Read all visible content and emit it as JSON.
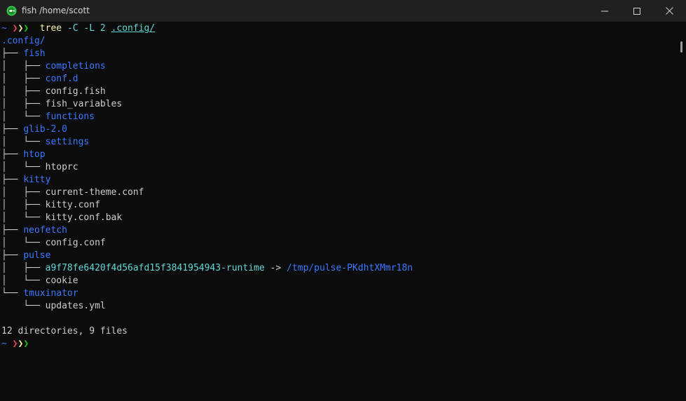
{
  "window": {
    "title": "fish /home/scott",
    "app_icon": "fish-icon",
    "controls": {
      "minimize_icon": "minimize-icon",
      "maximize_icon": "maximize-icon",
      "close_icon": "close-icon"
    }
  },
  "colors": {
    "background": "#0c0c0c",
    "titlebar": "#202020",
    "directory": "#3b78ff",
    "symlink": "#61d6d6",
    "text": "#cccccc",
    "prompt_red": "#e74856",
    "prompt_yellow": "#f9f1a5",
    "prompt_green": "#16c60c",
    "command": "#f9f1a5"
  },
  "terminal": {
    "prompt": {
      "cwd": "~",
      "arrows": [
        "❯",
        "❯",
        "❯"
      ]
    },
    "command": {
      "name": "tree",
      "flags": "-C -L 2",
      "path": ".config/"
    },
    "tree": {
      "root": ".config/",
      "lines": [
        {
          "prefix": "├── ",
          "name": "fish",
          "kind": "dir"
        },
        {
          "prefix": "│   ├── ",
          "name": "completions",
          "kind": "dir"
        },
        {
          "prefix": "│   ├── ",
          "name": "conf.d",
          "kind": "dir"
        },
        {
          "prefix": "│   ├── ",
          "name": "config.fish",
          "kind": "file"
        },
        {
          "prefix": "│   ├── ",
          "name": "fish_variables",
          "kind": "file"
        },
        {
          "prefix": "│   └── ",
          "name": "functions",
          "kind": "dir"
        },
        {
          "prefix": "├── ",
          "name": "glib-2.0",
          "kind": "dir"
        },
        {
          "prefix": "│   └── ",
          "name": "settings",
          "kind": "dir"
        },
        {
          "prefix": "├── ",
          "name": "htop",
          "kind": "dir"
        },
        {
          "prefix": "│   └── ",
          "name": "htoprc",
          "kind": "file"
        },
        {
          "prefix": "├── ",
          "name": "kitty",
          "kind": "dir"
        },
        {
          "prefix": "│   ├── ",
          "name": "current-theme.conf",
          "kind": "file"
        },
        {
          "prefix": "│   ├── ",
          "name": "kitty.conf",
          "kind": "file"
        },
        {
          "prefix": "│   └── ",
          "name": "kitty.conf.bak",
          "kind": "file"
        },
        {
          "prefix": "├── ",
          "name": "neofetch",
          "kind": "dir"
        },
        {
          "prefix": "│   └── ",
          "name": "config.conf",
          "kind": "file"
        },
        {
          "prefix": "├── ",
          "name": "pulse",
          "kind": "dir"
        },
        {
          "prefix": "│   ├── ",
          "name": "a9f78fe6420f4d56afd15f3841954943-runtime",
          "kind": "symlink",
          "arrow": " -> ",
          "target": "/tmp/pulse-PKdhtXMmr18n"
        },
        {
          "prefix": "│   └── ",
          "name": "cookie",
          "kind": "file"
        },
        {
          "prefix": "└── ",
          "name": "tmuxinator",
          "kind": "dir"
        },
        {
          "prefix": "    └── ",
          "name": "updates.yml",
          "kind": "file"
        }
      ]
    },
    "summary": "12 directories, 9 files"
  }
}
